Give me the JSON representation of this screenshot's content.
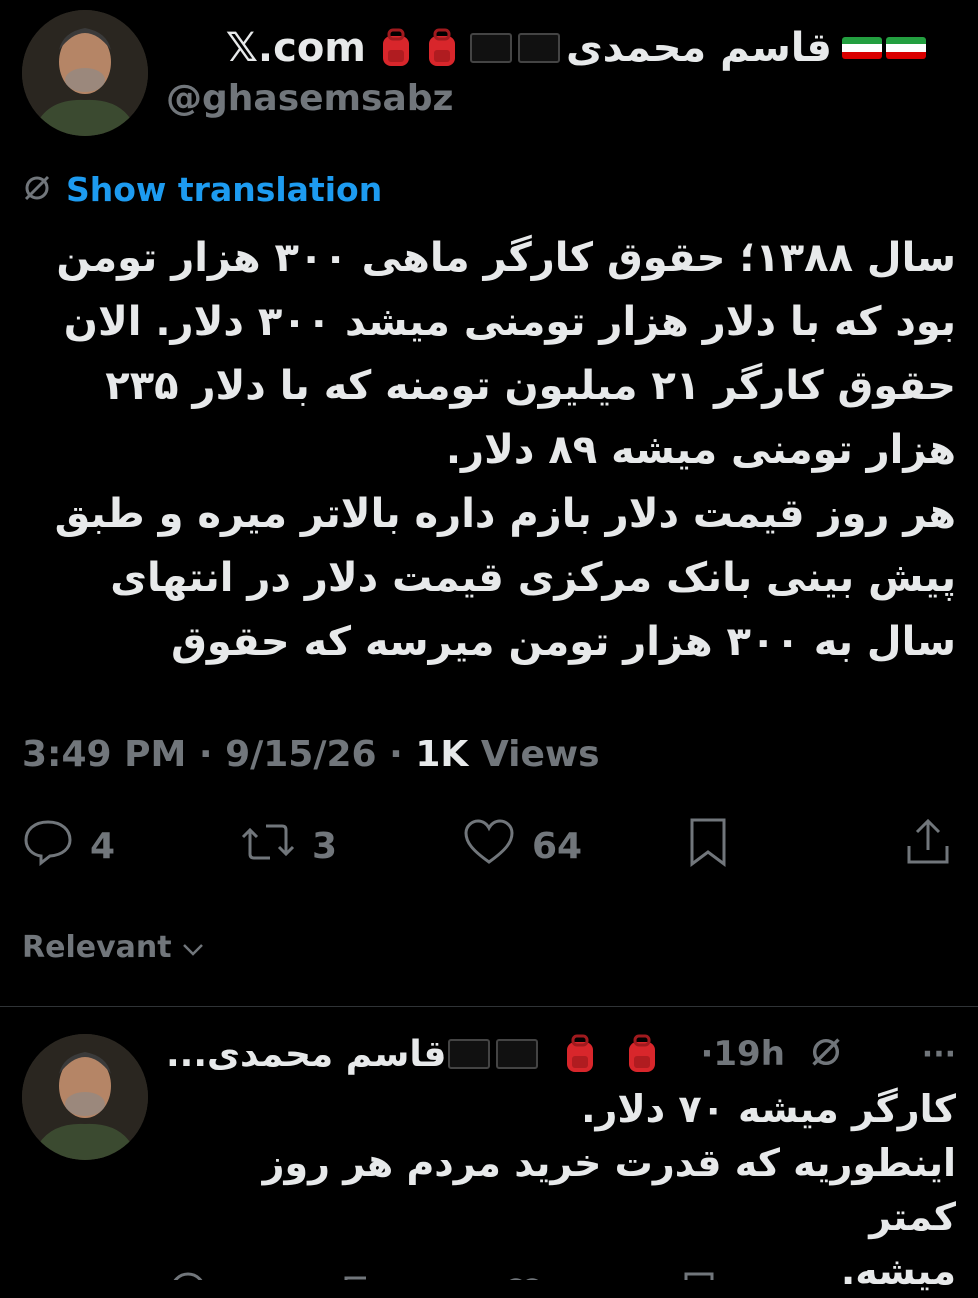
{
  "header": {
    "display_name": "قاسم محمدی",
    "handle": "@ghasemsabz",
    "site": "𝕏.com"
  },
  "translation": {
    "label": "Show translation"
  },
  "tweet": {
    "text": "سال ۱۳۸۸؛ حقوق کارگر ماهی ۳۰۰ هزار تومن\nبود که با دلار هزار تومنی میشد ۳۰۰ دلار. الان\nحقوق کارگر ۲۱ میلیون تومنه که با دلار ۲۳۵\nهزار تومنی میشه ۸۹ دلار.\nهر روز قیمت دلار بازم داره بالاتر میره و طبق\nپیش بینی بانک مرکزی قیمت دلار در انتهای\nسال به ۳۰۰ هزار تومن میرسه که حقوق",
    "time": "3:49 PM",
    "date": "9/15/26",
    "views_count": "1K",
    "views_label": "Views"
  },
  "actions": {
    "replies": "4",
    "reposts": "3",
    "likes": "64"
  },
  "sort": {
    "label": "Relevant"
  },
  "reply": {
    "display_name": "قاسم محمدی...",
    "age": "19h",
    "more": "···",
    "text": "کارگر  میشه ۷۰ دلار.\nاینطوریه که قدرت خرید مردم هر روز کمتر\nمیشه."
  },
  "colors": {
    "background": "#000000",
    "text": "#e7e9ea",
    "muted": "#71767b",
    "link": "#1d9bf0",
    "divider": "#2f3336"
  }
}
